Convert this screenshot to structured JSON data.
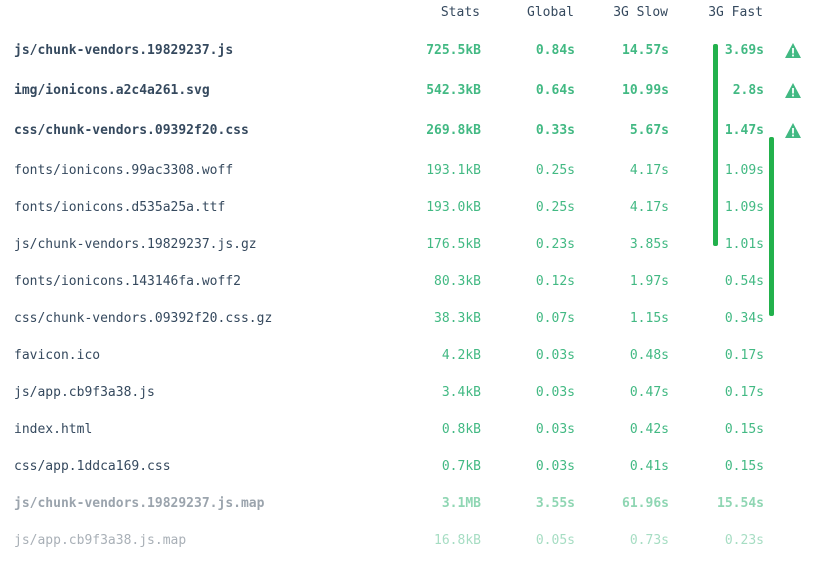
{
  "header": {
    "stats": "Stats",
    "global": "Global",
    "slow": "3G Slow",
    "fast": "3G Fast"
  },
  "rows": [
    {
      "name": "js/chunk-vendors.19829237.js",
      "stats": "725.5kB",
      "global": "0.84s",
      "slow": "14.57s",
      "fast": "3.69s"
    },
    {
      "name": "img/ionicons.a2c4a261.svg",
      "stats": "542.3kB",
      "global": "0.64s",
      "slow": "10.99s",
      "fast": "2.8s"
    },
    {
      "name": "css/chunk-vendors.09392f20.css",
      "stats": "269.8kB",
      "global": "0.33s",
      "slow": "5.67s",
      "fast": "1.47s"
    },
    {
      "name": "fonts/ionicons.99ac3308.woff",
      "stats": "193.1kB",
      "global": "0.25s",
      "slow": "4.17s",
      "fast": "1.09s"
    },
    {
      "name": "fonts/ionicons.d535a25a.ttf",
      "stats": "193.0kB",
      "global": "0.25s",
      "slow": "4.17s",
      "fast": "1.09s"
    },
    {
      "name": "js/chunk-vendors.19829237.js.gz",
      "stats": "176.5kB",
      "global": "0.23s",
      "slow": "3.85s",
      "fast": "1.01s"
    },
    {
      "name": "fonts/ionicons.143146fa.woff2",
      "stats": "80.3kB",
      "global": "0.12s",
      "slow": "1.97s",
      "fast": "0.54s"
    },
    {
      "name": "css/chunk-vendors.09392f20.css.gz",
      "stats": "38.3kB",
      "global": "0.07s",
      "slow": "1.15s",
      "fast": "0.34s"
    },
    {
      "name": "favicon.ico",
      "stats": "4.2kB",
      "global": "0.03s",
      "slow": "0.48s",
      "fast": "0.17s"
    },
    {
      "name": "js/app.cb9f3a38.js",
      "stats": "3.4kB",
      "global": "0.03s",
      "slow": "0.47s",
      "fast": "0.17s"
    },
    {
      "name": "index.html",
      "stats": "0.8kB",
      "global": "0.03s",
      "slow": "0.42s",
      "fast": "0.15s"
    },
    {
      "name": "css/app.1ddca169.css",
      "stats": "0.7kB",
      "global": "0.03s",
      "slow": "0.41s",
      "fast": "0.15s"
    },
    {
      "name": "js/chunk-vendors.19829237.js.map",
      "stats": "3.1MB",
      "global": "3.55s",
      "slow": "61.96s",
      "fast": "15.54s"
    },
    {
      "name": "js/app.cb9f3a38.js.map",
      "stats": "16.8kB",
      "global": "0.05s",
      "slow": "0.73s",
      "fast": "0.23s"
    }
  ],
  "colors": {
    "accent": "#42b983",
    "text": "#35495e",
    "warning": "#42b983",
    "annotation": "#22b14c"
  },
  "icons": {
    "warning": "warning-triangle-icon"
  }
}
